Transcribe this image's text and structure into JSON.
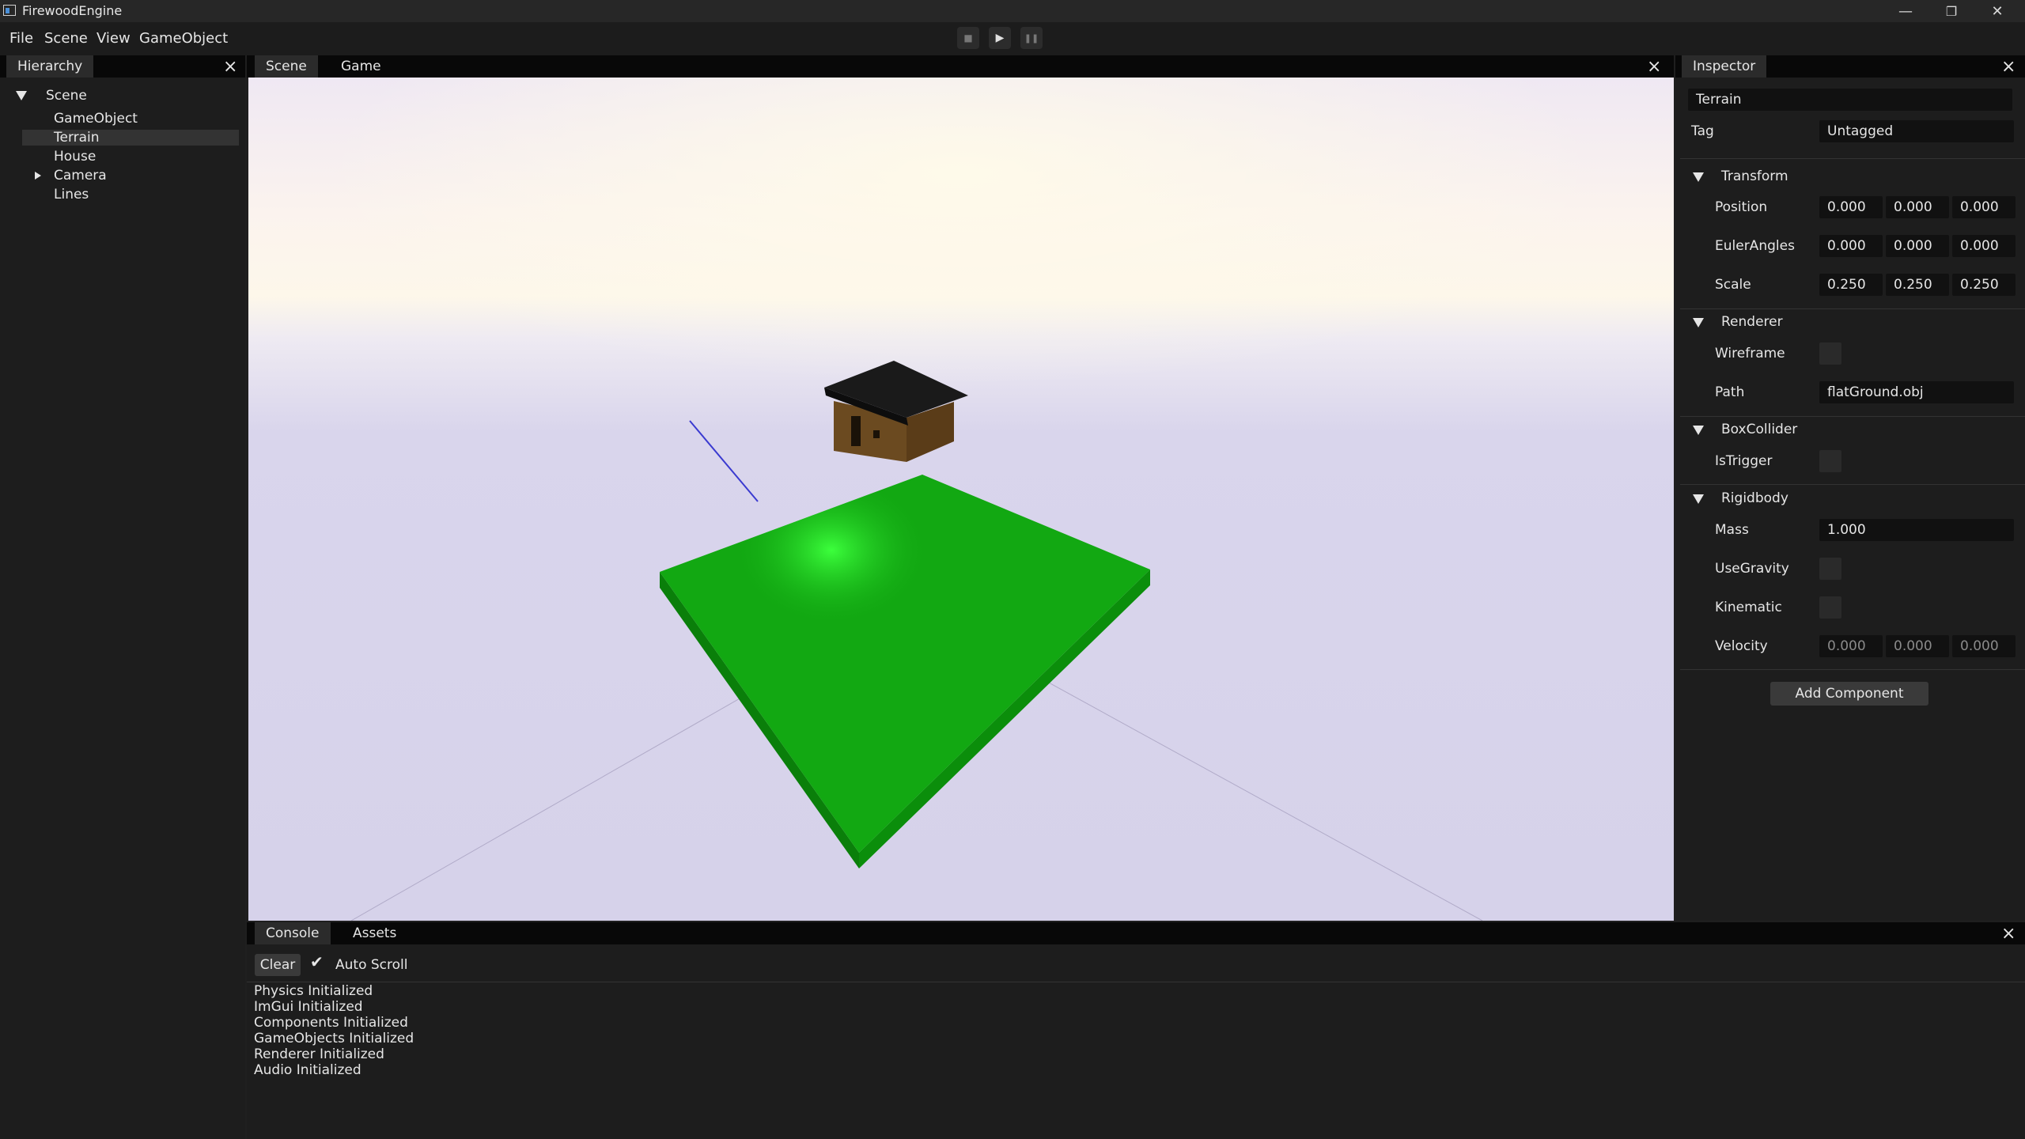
{
  "window": {
    "title": "FirewoodEngine",
    "controls": {
      "minimize": "—",
      "restore": "❐",
      "close": "✕"
    }
  },
  "menubar": {
    "items": [
      "File",
      "Scene",
      "View",
      "GameObject"
    ]
  },
  "playback": {
    "stop": "■",
    "play": "▶",
    "pause": "❚❚"
  },
  "hierarchy": {
    "tab": "Hierarchy",
    "root": "Scene",
    "items": [
      "GameObject",
      "Terrain",
      "House",
      "Camera",
      "Lines"
    ],
    "selected": "Terrain"
  },
  "viewport": {
    "tabs": [
      "Scene",
      "Game"
    ],
    "active_tab": "Scene",
    "colors": {
      "ground": "#12a812",
      "roof": "#1a1a1a",
      "walls": "#6b4a20"
    }
  },
  "inspector": {
    "tab": "Inspector",
    "name": "Terrain",
    "tag_label": "Tag",
    "tag_value": "Untagged",
    "transform": {
      "header": "Transform",
      "position_label": "Position",
      "position": [
        "0.000",
        "0.000",
        "0.000"
      ],
      "euler_label": "EulerAngles",
      "euler": [
        "0.000",
        "0.000",
        "0.000"
      ],
      "scale_label": "Scale",
      "scale": [
        "0.250",
        "0.250",
        "0.250"
      ]
    },
    "renderer": {
      "header": "Renderer",
      "wireframe_label": "Wireframe",
      "path_label": "Path",
      "path_value": "flatGround.obj"
    },
    "boxcollider": {
      "header": "BoxCollider",
      "istrigger_label": "IsTrigger"
    },
    "rigidbody": {
      "header": "Rigidbody",
      "mass_label": "Mass",
      "mass_value": "1.000",
      "usegravity_label": "UseGravity",
      "kinematic_label": "Kinematic",
      "velocity_label": "Velocity",
      "velocity": [
        "0.000",
        "0.000",
        "0.000"
      ]
    },
    "add_component": "Add Component"
  },
  "console": {
    "tabs": [
      "Console",
      "Assets"
    ],
    "clear": "Clear",
    "autoscroll": "Auto Scroll",
    "lines": [
      "Physics Initialized",
      "ImGui Initialized",
      "Components Initialized",
      "GameObjects Initialized",
      "Renderer Initialized",
      "Audio Initialized"
    ]
  }
}
